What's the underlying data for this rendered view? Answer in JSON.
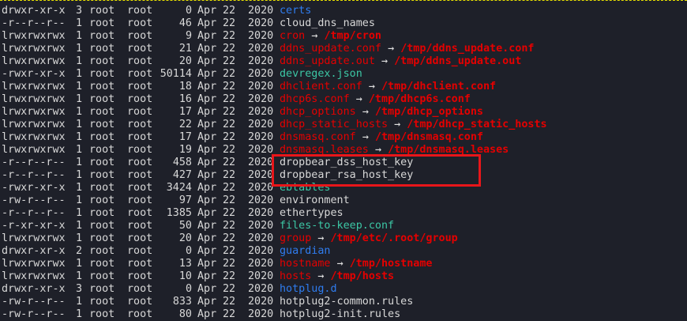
{
  "colors": {
    "dir": "#2f7df0",
    "link": "#e50000",
    "exec": "#3cc7a5",
    "file": "#d8d8d8",
    "highlight": "#e8161a"
  },
  "arrow": "→",
  "rows": [
    {
      "perm": "drwxr-xr-x",
      "links": "3",
      "owner": "root",
      "group": "root",
      "size": "0",
      "month": "Apr",
      "day": "22",
      "year": "2020",
      "name": "certs",
      "type": "dir"
    },
    {
      "perm": "-r--r--r--",
      "links": "1",
      "owner": "root",
      "group": "root",
      "size": "46",
      "month": "Apr",
      "day": "22",
      "year": "2020",
      "name": "cloud_dns_names",
      "type": "file"
    },
    {
      "perm": "lrwxrwxrwx",
      "links": "1",
      "owner": "root",
      "group": "root",
      "size": "9",
      "month": "Apr",
      "day": "22",
      "year": "2020",
      "name": "cron",
      "target": "/tmp/cron",
      "type": "link"
    },
    {
      "perm": "lrwxrwxrwx",
      "links": "1",
      "owner": "root",
      "group": "root",
      "size": "21",
      "month": "Apr",
      "day": "22",
      "year": "2020",
      "name": "ddns_update.conf",
      "target": "/tmp/ddns_update.conf",
      "type": "link"
    },
    {
      "perm": "lrwxrwxrwx",
      "links": "1",
      "owner": "root",
      "group": "root",
      "size": "20",
      "month": "Apr",
      "day": "22",
      "year": "2020",
      "name": "ddns_update.out",
      "target": "/tmp/ddns_update.out",
      "type": "link"
    },
    {
      "perm": "-rwxr-xr-x",
      "links": "1",
      "owner": "root",
      "group": "root",
      "size": "50114",
      "month": "Apr",
      "day": "22",
      "year": "2020",
      "name": "devregex.json",
      "type": "exec"
    },
    {
      "perm": "lrwxrwxrwx",
      "links": "1",
      "owner": "root",
      "group": "root",
      "size": "18",
      "month": "Apr",
      "day": "22",
      "year": "2020",
      "name": "dhclient.conf",
      "target": "/tmp/dhclient.conf",
      "type": "link"
    },
    {
      "perm": "lrwxrwxrwx",
      "links": "1",
      "owner": "root",
      "group": "root",
      "size": "16",
      "month": "Apr",
      "day": "22",
      "year": "2020",
      "name": "dhcp6s.conf",
      "target": "/tmp/dhcp6s.conf",
      "type": "link"
    },
    {
      "perm": "lrwxrwxrwx",
      "links": "1",
      "owner": "root",
      "group": "root",
      "size": "17",
      "month": "Apr",
      "day": "22",
      "year": "2020",
      "name": "dhcp_options",
      "target": "/tmp/dhcp_options",
      "type": "link"
    },
    {
      "perm": "lrwxrwxrwx",
      "links": "1",
      "owner": "root",
      "group": "root",
      "size": "22",
      "month": "Apr",
      "day": "22",
      "year": "2020",
      "name": "dhcp_static_hosts",
      "target": "/tmp/dhcp_static_hosts",
      "type": "link"
    },
    {
      "perm": "lrwxrwxrwx",
      "links": "1",
      "owner": "root",
      "group": "root",
      "size": "17",
      "month": "Apr",
      "day": "22",
      "year": "2020",
      "name": "dnsmasq.conf",
      "target": "/tmp/dnsmasq.conf",
      "type": "link"
    },
    {
      "perm": "lrwxrwxrwx",
      "links": "1",
      "owner": "root",
      "group": "root",
      "size": "19",
      "month": "Apr",
      "day": "22",
      "year": "2020",
      "name": "dnsmasq.leases",
      "target": "/tmp/dnsmasq.leases",
      "type": "link"
    },
    {
      "perm": "-r--r--r--",
      "links": "1",
      "owner": "root",
      "group": "root",
      "size": "458",
      "month": "Apr",
      "day": "22",
      "year": "2020",
      "name": "dropbear_dss_host_key",
      "type": "file"
    },
    {
      "perm": "-r--r--r--",
      "links": "1",
      "owner": "root",
      "group": "root",
      "size": "427",
      "month": "Apr",
      "day": "22",
      "year": "2020",
      "name": "dropbear_rsa_host_key",
      "type": "file"
    },
    {
      "perm": "-rwxr-xr-x",
      "links": "1",
      "owner": "root",
      "group": "root",
      "size": "3424",
      "month": "Apr",
      "day": "22",
      "year": "2020",
      "name": "ebtables",
      "type": "exec"
    },
    {
      "perm": "-rw-r--r--",
      "links": "1",
      "owner": "root",
      "group": "root",
      "size": "97",
      "month": "Apr",
      "day": "22",
      "year": "2020",
      "name": "environment",
      "type": "file"
    },
    {
      "perm": "-r--r--r--",
      "links": "1",
      "owner": "root",
      "group": "root",
      "size": "1385",
      "month": "Apr",
      "day": "22",
      "year": "2020",
      "name": "ethertypes",
      "type": "file"
    },
    {
      "perm": "-r-xr-xr-x",
      "links": "1",
      "owner": "root",
      "group": "root",
      "size": "50",
      "month": "Apr",
      "day": "22",
      "year": "2020",
      "name": "files-to-keep.conf",
      "type": "exec"
    },
    {
      "perm": "lrwxrwxrwx",
      "links": "1",
      "owner": "root",
      "group": "root",
      "size": "20",
      "month": "Apr",
      "day": "22",
      "year": "2020",
      "name": "group",
      "target": "/tmp/etc/.root/group",
      "type": "link"
    },
    {
      "perm": "drwxr-xr-x",
      "links": "2",
      "owner": "root",
      "group": "root",
      "size": "0",
      "month": "Apr",
      "day": "22",
      "year": "2020",
      "name": "guardian",
      "type": "dir"
    },
    {
      "perm": "lrwxrwxrwx",
      "links": "1",
      "owner": "root",
      "group": "root",
      "size": "13",
      "month": "Apr",
      "day": "22",
      "year": "2020",
      "name": "hostname",
      "target": "/tmp/hostname",
      "type": "link"
    },
    {
      "perm": "lrwxrwxrwx",
      "links": "1",
      "owner": "root",
      "group": "root",
      "size": "10",
      "month": "Apr",
      "day": "22",
      "year": "2020",
      "name": "hosts",
      "target": "/tmp/hosts",
      "type": "link"
    },
    {
      "perm": "drwxr-xr-x",
      "links": "3",
      "owner": "root",
      "group": "root",
      "size": "0",
      "month": "Apr",
      "day": "22",
      "year": "2020",
      "name": "hotplug.d",
      "type": "dir"
    },
    {
      "perm": "-rw-r--r--",
      "links": "1",
      "owner": "root",
      "group": "root",
      "size": "833",
      "month": "Apr",
      "day": "22",
      "year": "2020",
      "name": "hotplug2-common.rules",
      "type": "file"
    },
    {
      "perm": "-rw-r--r--",
      "links": "1",
      "owner": "root",
      "group": "root",
      "size": "80",
      "month": "Apr",
      "day": "22",
      "year": "2020",
      "name": "hotplug2-init.rules",
      "type": "file"
    }
  ]
}
